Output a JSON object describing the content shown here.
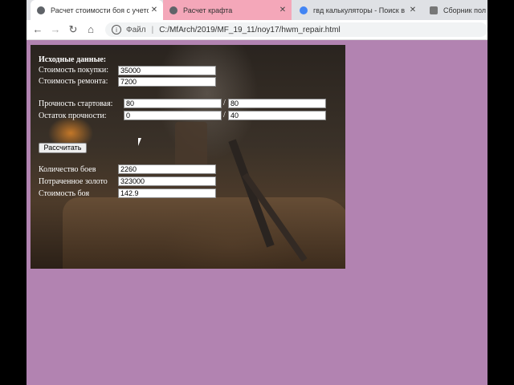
{
  "browser": {
    "tabs": [
      {
        "title": "Расчет стоимости боя с учето",
        "active": true
      },
      {
        "title": "Расчет крафта",
        "active": false
      },
      {
        "title": "гвд калькуляторы - Поиск в G",
        "active": false
      },
      {
        "title": "Сборник пол",
        "active": false
      }
    ],
    "address": {
      "label": "Файл",
      "url": "C:/MfArch/2019/MF_19_11/noy17/hwm_repair.html"
    },
    "icons": {
      "back": "back-arrow-icon",
      "forward": "forward-arrow-icon",
      "reload": "reload-icon",
      "home": "home-icon",
      "info": "info-icon"
    }
  },
  "form": {
    "heading": "Исходные данные:",
    "purchase_label": "Стоимость покупки:",
    "purchase_value": "35000",
    "repair_label": "Стоимость ремонта:",
    "repair_value": "7200",
    "durability_label": "Прочность стартовая:",
    "durability_current": "80",
    "durability_max": "80",
    "remaining_label": "Остаток прочности:",
    "remaining_current": "0",
    "remaining_max": "40",
    "slash": "/",
    "calc_button": "Рассчитать"
  },
  "results": {
    "battles_label": "Количество боев",
    "battles_value": "2260",
    "gold_label": "Потраченное золото",
    "gold_value": "323000",
    "cost_label": "Стоимость боя",
    "cost_value": "142.9"
  },
  "colors": {
    "page_bg": "#b283b1",
    "tab_pink": "#f4a7b9"
  }
}
